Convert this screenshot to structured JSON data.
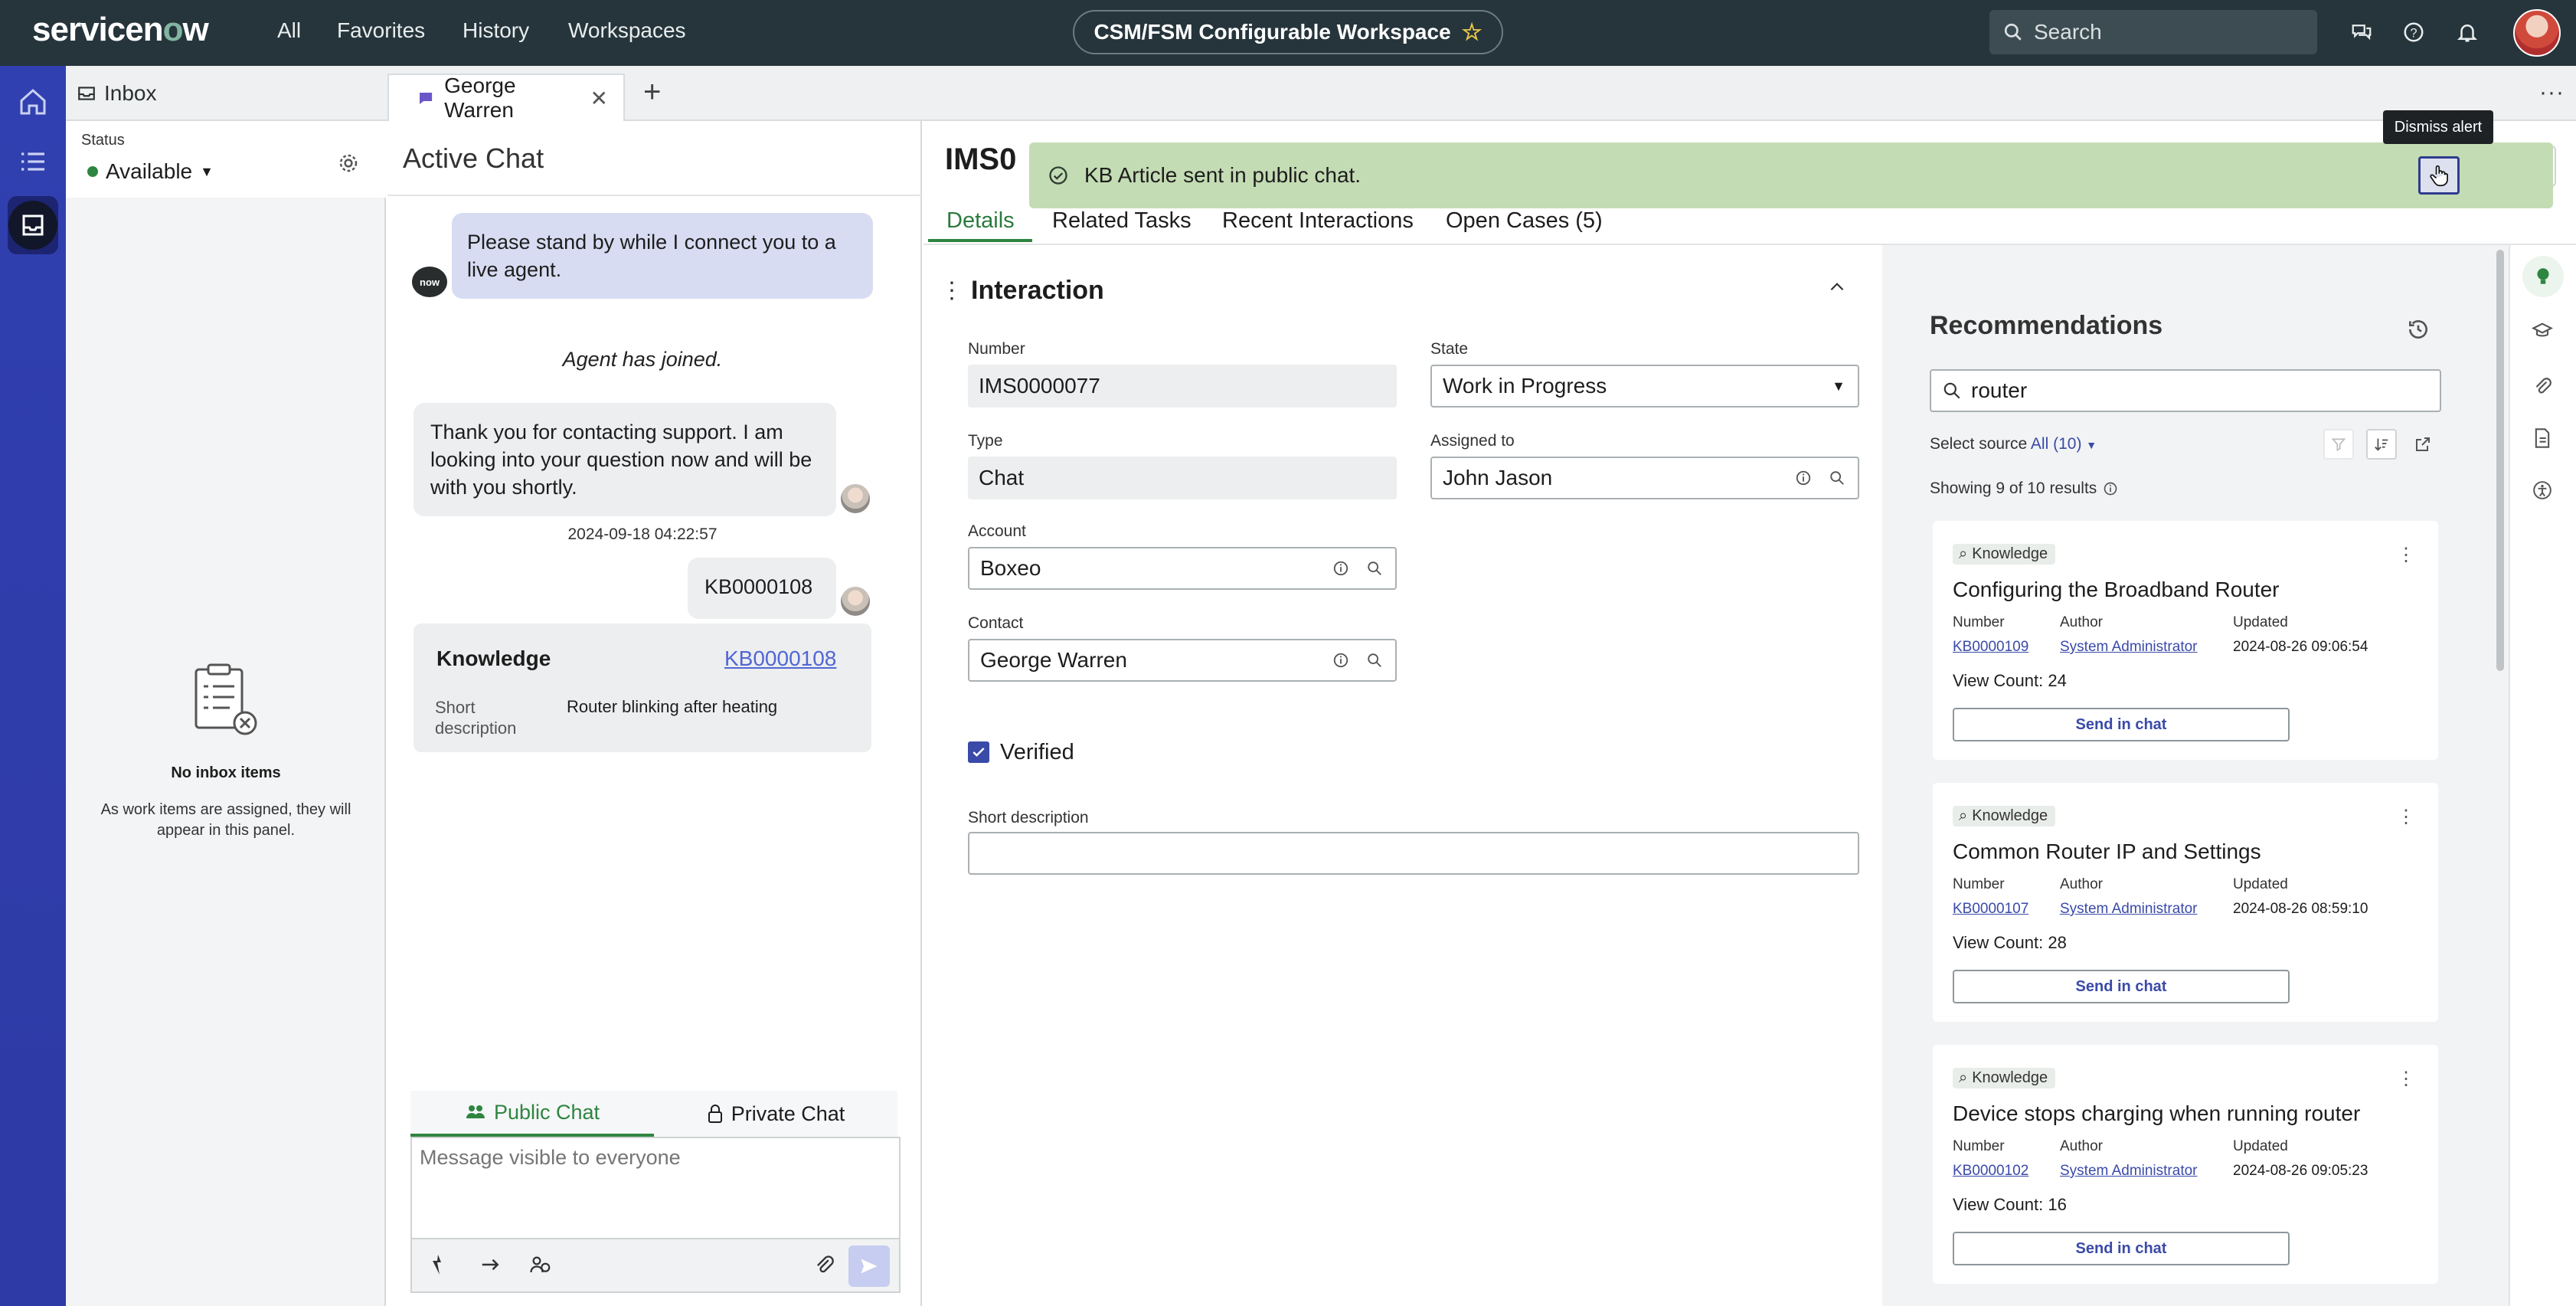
{
  "topbar": {
    "logo": "servicenow",
    "nav": [
      "All",
      "Favorites",
      "History",
      "Workspaces"
    ],
    "workspace_title": "CSM/FSM Configurable Workspace",
    "search_placeholder": "Search"
  },
  "tabs": {
    "inbox_label": "Inbox",
    "chat_tab_label": "George Warren",
    "more": "···"
  },
  "inbox": {
    "status_label": "Status",
    "status_value": "Available",
    "empty_title": "No inbox items",
    "empty_desc": "As work items are assigned, they will appear in this panel."
  },
  "chat": {
    "title": "Active Chat",
    "badge": "now",
    "msg1": "Please stand by while I connect you to a live agent.",
    "joined": "Agent has joined.",
    "msg2": "Thank you for contacting support. I am looking into your question now and will be with you shortly.",
    "timestamp": "2024-09-18 04:22:57",
    "msg3": "KB0000108",
    "card_title": "Knowledge",
    "card_link": "KB0000108",
    "card_short_label": "Short description",
    "card_short_value": "Router blinking after heating",
    "public_tab": "Public Chat",
    "private_tab": "Private Chat",
    "composer_placeholder": "Message visible to everyone"
  },
  "record": {
    "title": "IMS0",
    "tabs": [
      "Details",
      "Related Tasks",
      "Recent Interactions",
      "Open Cases (5)"
    ],
    "alert_text": "KB Article sent in public chat.",
    "tooltip": "Dismiss alert",
    "section_title": "Interaction",
    "fields": {
      "number_label": "Number",
      "number_value": "IMS0000077",
      "state_label": "State",
      "state_value": "Work in Progress",
      "type_label": "Type",
      "type_value": "Chat",
      "assigned_label": "Assigned to",
      "assigned_value": "John Jason",
      "account_label": "Account",
      "account_value": "Boxeo",
      "contact_label": "Contact",
      "contact_value": "George Warren",
      "verified_label": "Verified",
      "short_desc_label": "Short description",
      "short_desc_value": ""
    }
  },
  "recommendations": {
    "title": "Recommendations",
    "search_value": "router",
    "source_label": "Select source",
    "source_value": "All (10)",
    "showing": "Showing 9 of 10 results",
    "col_number": "Number",
    "col_author": "Author",
    "col_updated": "Updated",
    "badge": "Knowledge",
    "send_label": "Send in chat",
    "items": [
      {
        "title": "Configuring the Broadband Router",
        "number": "KB0000109",
        "author": "System Administrator",
        "updated": "2024-08-26 09:06:54",
        "views": "View Count: 24"
      },
      {
        "title": "Common Router IP and Settings",
        "number": "KB0000107",
        "author": "System Administrator",
        "updated": "2024-08-26 08:59:10",
        "views": "View Count: 28"
      },
      {
        "title": "Device stops charging when running router",
        "number": "KB0000102",
        "author": "System Administrator",
        "updated": "2024-08-26 09:05:23",
        "views": "View Count: 16"
      }
    ]
  },
  "colors": {
    "topbar": "#26353b",
    "rail": "#2e3aa5",
    "accent_green": "#2e8540",
    "alert_bg": "#c4dcb4",
    "link": "#3a4aa8"
  }
}
